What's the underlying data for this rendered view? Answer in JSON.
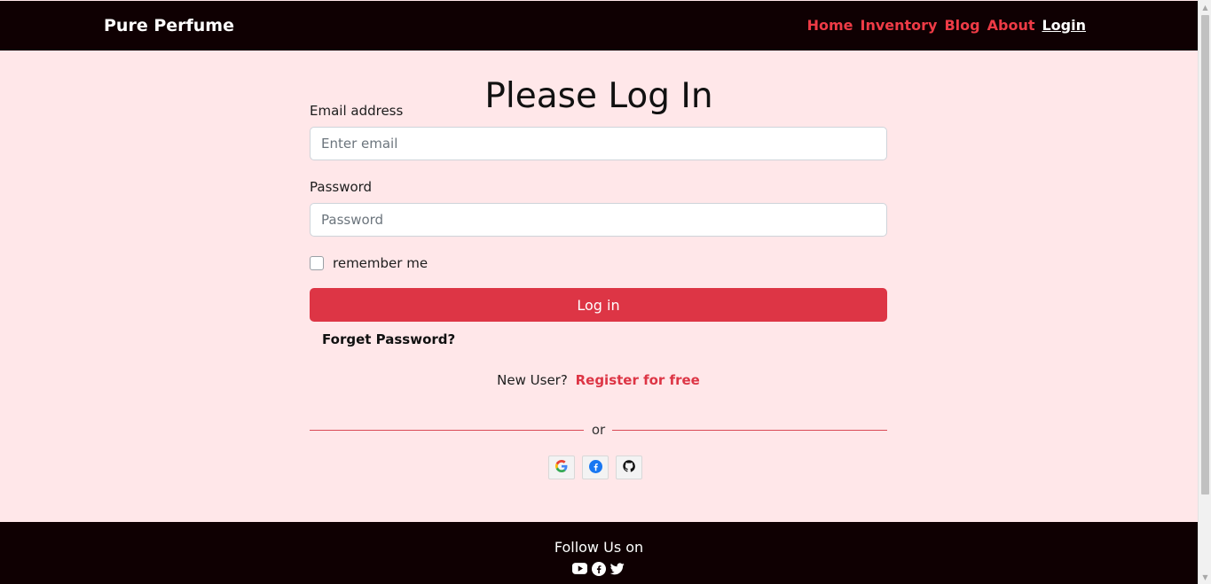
{
  "header": {
    "brand": "Pure Perfume",
    "nav": [
      {
        "label": "Home"
      },
      {
        "label": "Inventory"
      },
      {
        "label": "Blog"
      },
      {
        "label": "About"
      },
      {
        "label": "Login"
      }
    ]
  },
  "login": {
    "title": "Please Log In",
    "email_label": "Email address",
    "email_placeholder": "Enter email",
    "password_label": "Password",
    "password_placeholder": "Password",
    "remember_label": "remember me",
    "submit_label": "Log in",
    "forgot_label": "Forget Password?",
    "new_user_text": "New User?",
    "register_label": "Register for free",
    "divider_text": "or",
    "social_icons": [
      "google-icon",
      "facebook-icon",
      "github-icon"
    ]
  },
  "footer": {
    "title": "Follow Us on",
    "icons": [
      "youtube-icon",
      "facebook-icon",
      "twitter-icon"
    ]
  },
  "colors": {
    "nav_bg": "#0f0002",
    "page_bg": "#ffe7e9",
    "accent": "#dd3545",
    "nav_link": "#ee3b46"
  }
}
